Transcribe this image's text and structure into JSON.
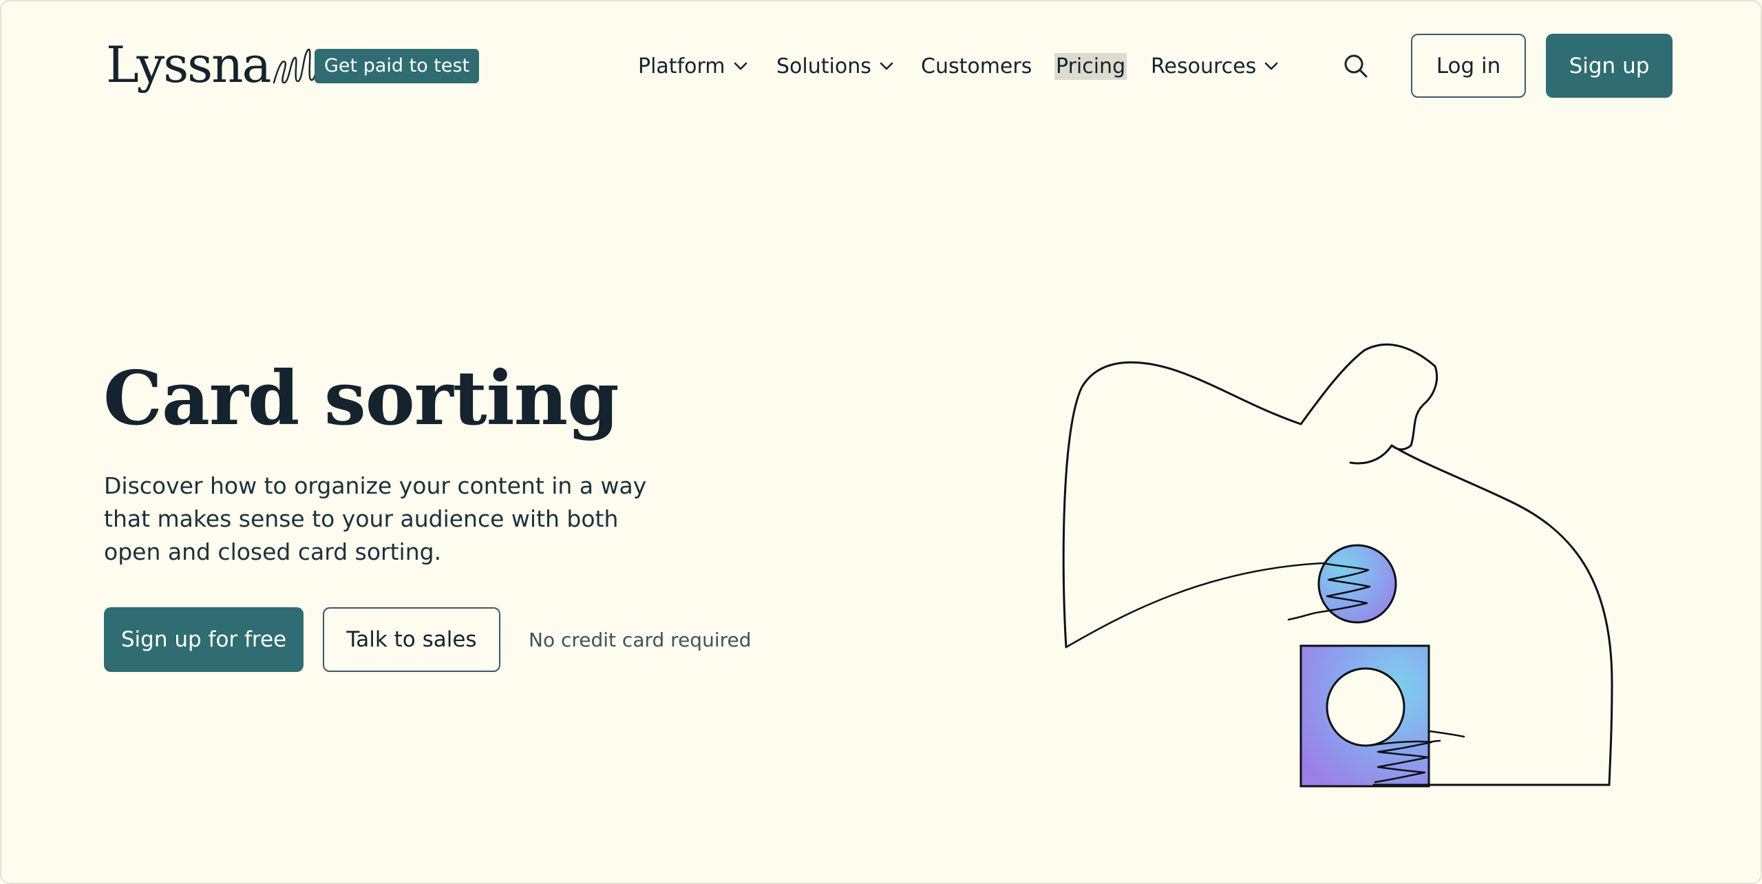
{
  "header": {
    "logo_text": "Lyssna",
    "badge_label": "Get paid to test",
    "nav": [
      {
        "label": "Platform",
        "has_dropdown": true
      },
      {
        "label": "Solutions",
        "has_dropdown": true
      },
      {
        "label": "Customers",
        "has_dropdown": false
      },
      {
        "label": "Pricing",
        "has_dropdown": false,
        "highlighted": true
      },
      {
        "label": "Resources",
        "has_dropdown": true
      }
    ],
    "search_icon": "search-icon",
    "login_label": "Log in",
    "signup_label": "Sign up"
  },
  "hero": {
    "title": "Card sorting",
    "description": "Discover how to organize your content in a way that makes sense to your audience with both open and closed card sorting.",
    "primary_cta": "Sign up for free",
    "secondary_cta": "Talk to sales",
    "note": "No credit card required"
  },
  "colors": {
    "background": "#fdfcee",
    "brand_teal": "#2f6d72",
    "text_dark": "#14232e",
    "highlight": "#dcdbcd",
    "illustration_blue": "#7fd0ec",
    "illustration_purple": "#9b7ee6"
  }
}
